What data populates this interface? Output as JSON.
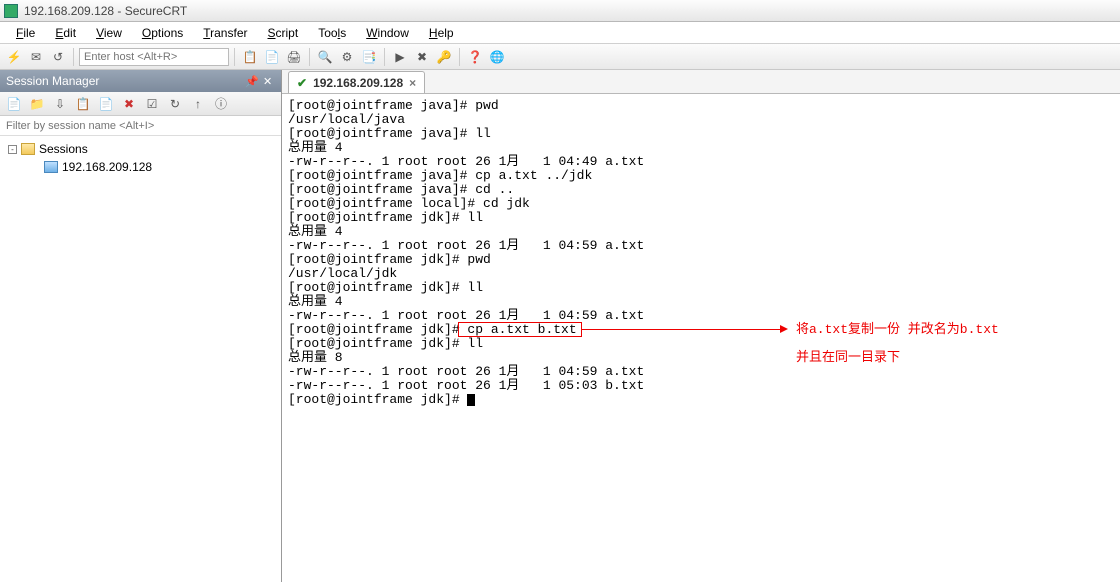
{
  "titlebar": {
    "text": "192.168.209.128 - SecureCRT"
  },
  "menu": {
    "file": "File",
    "edit": "Edit",
    "view": "View",
    "options": "Options",
    "transfer": "Transfer",
    "script": "Script",
    "tools": "Tools",
    "window": "Window",
    "help": "Help"
  },
  "toolbar": {
    "host_placeholder": "Enter host <Alt+R>"
  },
  "sidebar": {
    "title": "Session Manager",
    "filter_placeholder": "Filter by session name <Alt+I>",
    "root_label": "Sessions",
    "session_label": "192.168.209.128"
  },
  "tab": {
    "title": "192.168.209.128",
    "close": "×",
    "check": "✔"
  },
  "terminal": {
    "lines": [
      "[root@jointframe java]# pwd",
      "/usr/local/java",
      "[root@jointframe java]# ll",
      "总用量 4",
      "-rw-r--r--. 1 root root 26 1月   1 04:49 a.txt",
      "[root@jointframe java]# cp a.txt ../jdk",
      "[root@jointframe java]# cd ..",
      "[root@jointframe local]# cd jdk",
      "[root@jointframe jdk]# ll",
      "总用量 4",
      "-rw-r--r--. 1 root root 26 1月   1 04:59 a.txt",
      "[root@jointframe jdk]# pwd",
      "/usr/local/jdk",
      "[root@jointframe jdk]# ll",
      "总用量 4",
      "-rw-r--r--. 1 root root 26 1月   1 04:59 a.txt",
      "[root@jointframe jdk]# cp a.txt b.txt",
      "[root@jointframe jdk]# ll",
      "总用量 8",
      "-rw-r--r--. 1 root root 26 1月   1 04:59 a.txt",
      "-rw-r--r--. 1 root root 26 1月   1 05:03 b.txt",
      "[root@jointframe jdk]# "
    ]
  },
  "annotation": {
    "line1": "将a.txt复制一份 并改名为b.txt",
    "line2": "并且在同一目录下"
  }
}
